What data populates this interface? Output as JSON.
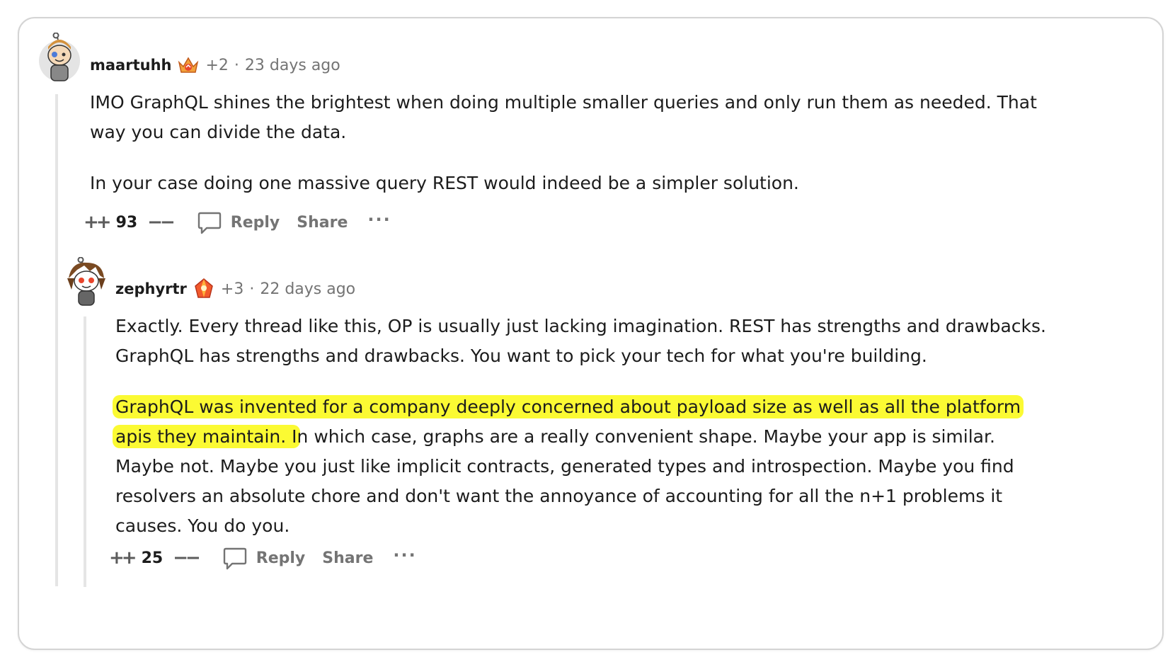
{
  "comments": [
    {
      "username": "maartuhh",
      "karma": "+2",
      "separator": "·",
      "time": "23 days ago",
      "paragraphs": [
        "IMO GraphQL shines the brightest when doing multiple smaller queries and only run them as needed. That way you can divide the data.",
        "In your case doing one massive query REST would indeed be a simpler solution."
      ],
      "upvote_icon": "++",
      "downvote_icon": "−−",
      "score": "93",
      "reply_label": "Reply",
      "share_label": "Share",
      "more_label": "···"
    },
    {
      "username": "zephyrtr",
      "karma": "+3",
      "separator": "·",
      "time": "22 days ago",
      "paragraphs": [
        "Exactly. Every thread like this, OP is usually just lacking imagination. REST has strengths and drawbacks. GraphQL has strengths and drawbacks. You want to pick your tech for what you're building."
      ],
      "highlighted_text": "GraphQL was invented for a company deeply concerned about payload size as well as all the platform apis they maintain. I",
      "after_highlight_text": "n which case, graphs are a really convenient shape. Maybe your app is similar. Maybe not. Maybe you just like implicit contracts, generated types and introspection. Maybe you find resolvers an absolute chore and don't want the annoyance of accounting for all the n+1 problems it causes. You do you.",
      "upvote_icon": "++",
      "downvote_icon": "−−",
      "score": "25",
      "reply_label": "Reply",
      "share_label": "Share",
      "more_label": "···"
    }
  ],
  "colors": {
    "highlight": "#fbfa33",
    "muted_text": "#747474",
    "thread_line": "#e5e5e5",
    "border": "#d4d4d4"
  },
  "icons": [
    "avatar-maartuhh",
    "avatar-zephyrtr",
    "flair-crown-icon",
    "flair-gem-icon",
    "comment-bubble-icon",
    "more-dots-icon"
  ]
}
